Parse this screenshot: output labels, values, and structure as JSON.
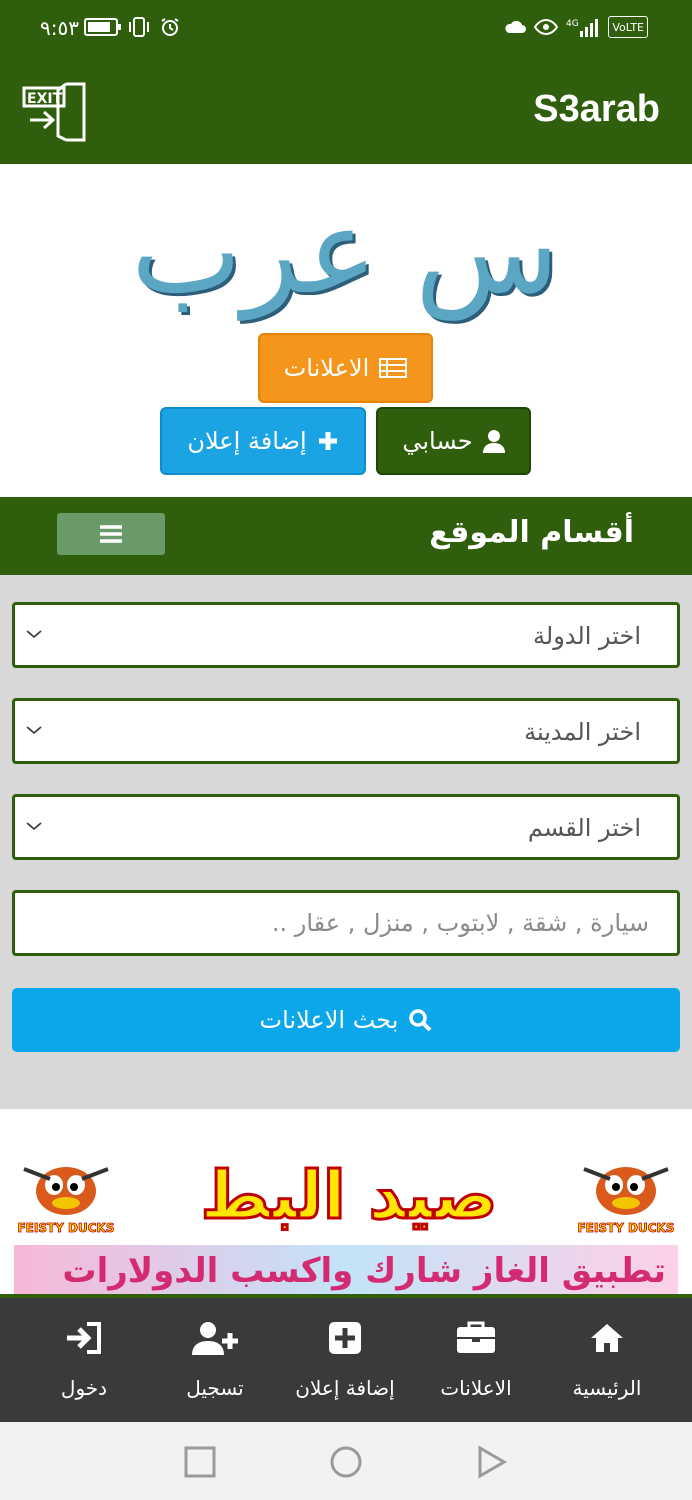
{
  "status_bar": {
    "time": "٩:٥٣",
    "battery_level": 0.85,
    "network": "4G",
    "volte": "VoLTE"
  },
  "app_bar": {
    "title": "S3arab",
    "exit_label": "EXIT"
  },
  "logo": {
    "text": "س عرب"
  },
  "buttons": {
    "ads": "الاعلانات",
    "add_ad": "إضافة إعلان",
    "account": "حسابي"
  },
  "sections": {
    "label": "أقسام الموقع"
  },
  "form": {
    "country_select": "اختر الدولة",
    "city_select": "اختر المدينة",
    "category_select": "اختر القسم",
    "search_placeholder": "سيارة , شقة , لابتوب , منزل , عقار ..",
    "search_button": "بحث الاعلانات"
  },
  "ad": {
    "title": "صيد البط",
    "duck_label": "FEISTY DUCKS",
    "banner2_text": "تطبيق الغاز شارك واكسب الدولارات"
  },
  "bottom_nav": {
    "home": "الرئيسية",
    "ads": "الاعلانات",
    "add_ad": "إضافة إعلان",
    "register": "تسجيل",
    "login": "دخول"
  },
  "colors": {
    "primary": "#2f5e0c",
    "orange": "#f5951c",
    "blue": "#1aa4e4",
    "search_blue": "#0ba7ea",
    "nav_bg": "#3a3a3a"
  }
}
